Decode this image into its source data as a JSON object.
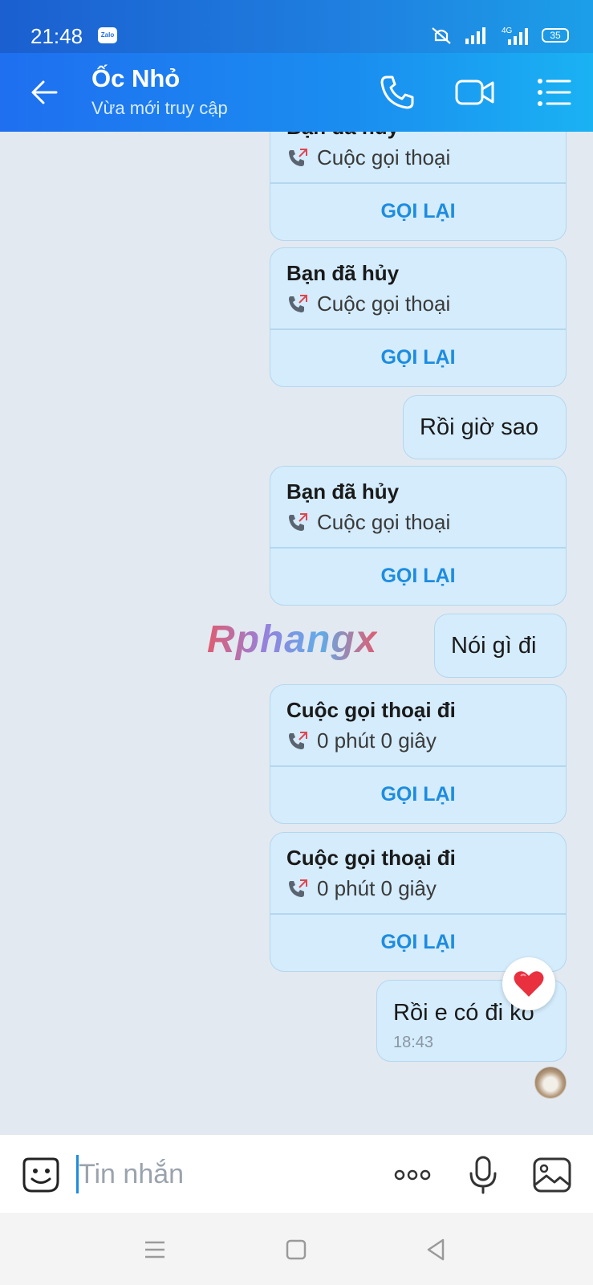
{
  "status_bar": {
    "time": "21:48",
    "app_badge": "Zalo",
    "battery": "35",
    "network": "4G"
  },
  "header": {
    "title": "Ốc Nhỏ",
    "subtitle": "Vừa mới truy cập"
  },
  "messages": [
    {
      "kind": "call",
      "title": "Bạn đã hủy",
      "detail": "Cuộc gọi thoại",
      "action": "GỌI LẠI"
    },
    {
      "kind": "call",
      "title": "Bạn đã hủy",
      "detail": "Cuộc gọi thoại",
      "action": "GỌI LẠI"
    },
    {
      "kind": "text",
      "text": "Rồi giờ sao"
    },
    {
      "kind": "call",
      "title": "Bạn đã hủy",
      "detail": "Cuộc gọi thoại",
      "action": "GỌI LẠI"
    },
    {
      "kind": "text",
      "text": "Nói gì đi"
    },
    {
      "kind": "call",
      "title": "Cuộc gọi thoại đi",
      "detail": "0 phút 0 giây",
      "action": "GỌI LẠI"
    },
    {
      "kind": "call",
      "title": "Cuộc gọi thoại đi",
      "detail": "0 phút 0 giây",
      "action": "GỌI LẠI"
    },
    {
      "kind": "text",
      "text": "Rồi e có đi ko",
      "time": "18:43"
    }
  ],
  "watermark": "Rphangx",
  "composer": {
    "placeholder": "Tin nhắn"
  },
  "colors": {
    "header_start": "#1f6ff0",
    "header_end": "#1ab2f3",
    "bubble": "#d4ecfc",
    "accent": "#1d8ce0",
    "chat_bg": "#e2e9f1"
  }
}
